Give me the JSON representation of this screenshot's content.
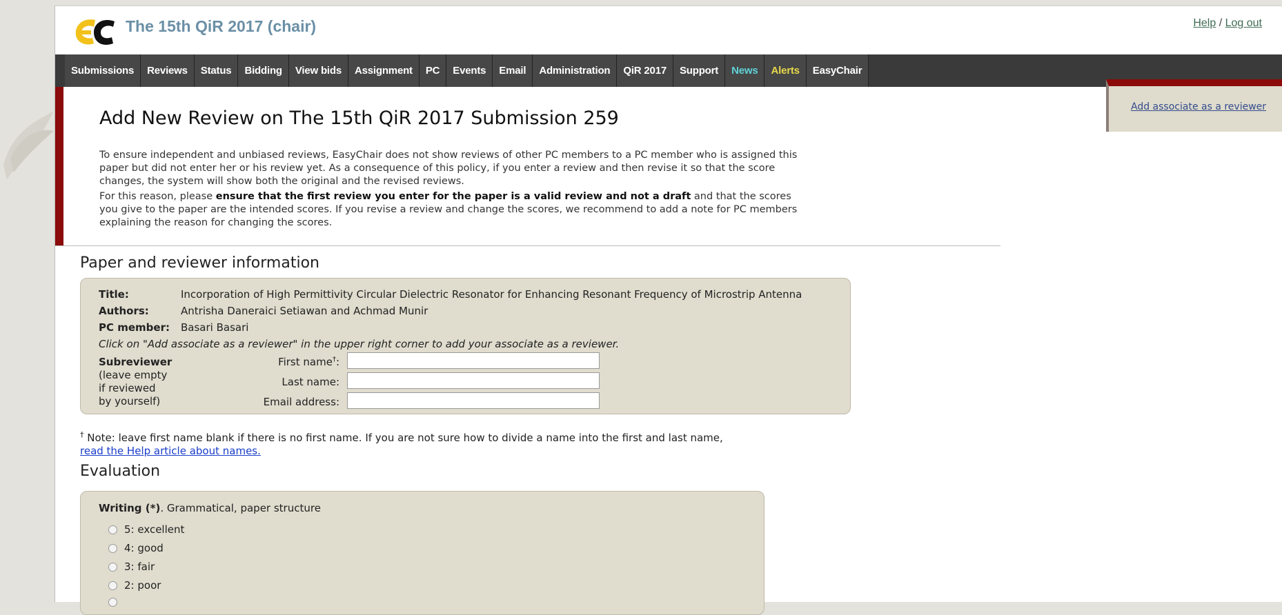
{
  "header": {
    "logo_text": "EC",
    "app_title": "The 15th QiR 2017 (chair)",
    "help_link": "Help",
    "separator": "/",
    "logout_link": "Log out"
  },
  "nav": {
    "items": [
      "Submissions",
      "Reviews",
      "Status",
      "Bidding",
      "View bids",
      "Assignment",
      "PC",
      "Events",
      "Email",
      "Administration",
      "QiR 2017",
      "Support",
      "News",
      "Alerts",
      "EasyChair"
    ]
  },
  "side_panel": {
    "link": "Add associate as a reviewer"
  },
  "intro": {
    "title": "Add New Review on The 15th QiR 2017 Submission 259",
    "p1": "To ensure independent and unbiased reviews, EasyChair does not show reviews of other PC members to a PC member who is assigned this paper but did not enter her or his review yet. As a consequence of this policy, if you enter a review and then revise it so that the score changes, the system will show both the original and the revised reviews.",
    "p2_pre": "For this reason, please ",
    "p2_bold": "ensure that the first review you enter for the paper is a valid review and not a draft",
    "p2_post": " and that the scores you give to the paper are the intended scores. If you revise a review and change the scores, we recommend to add a note for PC members explaining the reason for changing the scores."
  },
  "paper_section": {
    "title": "Paper and reviewer information",
    "title_label": "Title:",
    "title_value": "Incorporation of High Permittivity Circular Dielectric Resonator for Enhancing Resonant Frequency of Microstrip Antenna",
    "authors_label": "Authors:",
    "authors_value": "Antrisha Daneraici Setiawan and Achmad Munir",
    "pc_label": "PC member:",
    "pc_value": "Basari Basari",
    "hint": "Click on \"Add associate as a reviewer\" in the upper right corner to add your associate as a reviewer.",
    "subreviewer_label": "Subreviewer",
    "subreviewer_note_1": "(leave empty",
    "subreviewer_note_2": "if reviewed",
    "subreviewer_note_3": "by yourself)",
    "first_name_label": "First name",
    "first_name_mark": "†",
    "first_name_colon": ":",
    "last_name_label": "Last name:",
    "email_label": "Email address:",
    "first_name_value": "",
    "last_name_value": "",
    "email_value": ""
  },
  "name_note": {
    "mark": "†",
    "text": " Note: leave first name blank if there is no first name. If you are not sure how to divide a name into the first and last name,",
    "link": "read the Help article about names."
  },
  "evaluation": {
    "title": "Evaluation",
    "question_bold": "Writing (*)",
    "question_rest": ". Grammatical, paper structure",
    "options": [
      "5: excellent",
      "4: good",
      "3: fair",
      "2: poor"
    ]
  },
  "colors": {
    "nav_bg": "#3a3a3a",
    "accent_red": "#8b0a0a",
    "title_blue": "#6b8fa6",
    "box_bg": "#e0dcce",
    "news": "#5fd3d8",
    "alerts": "#e8d84a"
  }
}
